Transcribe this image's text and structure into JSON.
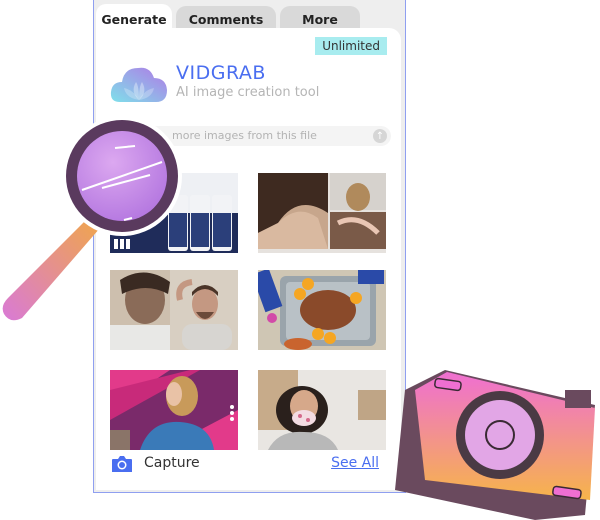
{
  "tabs": [
    {
      "label": "Generate",
      "active": true
    },
    {
      "label": "Comments",
      "active": false
    },
    {
      "label": "More",
      "active": false
    }
  ],
  "plan_badge": "Unlimited",
  "brand": {
    "name": "VIDGRAB",
    "tagline": "AI image creation tool",
    "logo_icon": "cloud-lotus-logo",
    "accent_color": "#4a6ef0"
  },
  "more_images": {
    "text": "more images from this file",
    "button_icon": "arrow-up-icon"
  },
  "images": [
    {
      "subject": "hair treatment product bottles"
    },
    {
      "subject": "hair loss scalp collage"
    },
    {
      "subject": "man checking hairline in mirror"
    },
    {
      "subject": "roast ham with orange slices"
    },
    {
      "subject": "woman with blonde hair against pink wall"
    },
    {
      "subject": "woman drinking from teacup"
    }
  ],
  "footer": {
    "capture_label": "Capture",
    "capture_icon": "camera-icon",
    "see_all_label": "See All"
  },
  "decorations": [
    "magnifying-glass-illustration",
    "camera-illustration"
  ]
}
